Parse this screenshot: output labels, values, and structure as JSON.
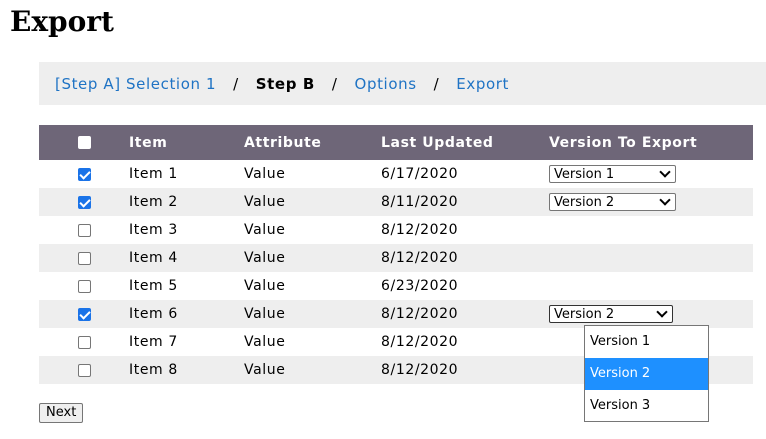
{
  "page": {
    "title": "Export"
  },
  "breadcrumb": {
    "step_a": "[Step A] Selection 1",
    "step_b": "Step B",
    "options": "Options",
    "export": "Export",
    "separator": "/"
  },
  "table": {
    "headers": {
      "item": "Item",
      "attribute": "Attribute",
      "last_updated": "Last Updated",
      "version_to_export": "Version To Export"
    },
    "header_checked": false,
    "rows": [
      {
        "checked": true,
        "item": "Item 1",
        "attribute": "Value",
        "last_updated": "6/17/2020",
        "version": "Version 1"
      },
      {
        "checked": true,
        "item": "Item 2",
        "attribute": "Value",
        "last_updated": "8/11/2020",
        "version": "Version 2"
      },
      {
        "checked": false,
        "item": "Item 3",
        "attribute": "Value",
        "last_updated": "8/12/2020",
        "version": ""
      },
      {
        "checked": false,
        "item": "Item 4",
        "attribute": "Value",
        "last_updated": "8/12/2020",
        "version": ""
      },
      {
        "checked": false,
        "item": "Item 5",
        "attribute": "Value",
        "last_updated": "6/23/2020",
        "version": ""
      },
      {
        "checked": true,
        "item": "Item 6",
        "attribute": "Value",
        "last_updated": "8/12/2020",
        "version": "Version 2"
      },
      {
        "checked": false,
        "item": "Item 7",
        "attribute": "Value",
        "last_updated": "8/12/2020",
        "version": ""
      },
      {
        "checked": false,
        "item": "Item 8",
        "attribute": "Value",
        "last_updated": "8/12/2020",
        "version": ""
      }
    ]
  },
  "dropdown": {
    "open_row": 6,
    "options": [
      {
        "label": "Version 1",
        "selected": false
      },
      {
        "label": "Version 2",
        "selected": true
      },
      {
        "label": "Version 3",
        "selected": false
      }
    ]
  },
  "actions": {
    "next_label": "Next"
  },
  "colors": {
    "header_bg": "#6e6678",
    "link": "#1f73c4",
    "stripe": "#eeeeee",
    "checkbox_checked": "#1a73e8",
    "option_selected": "#1e90ff"
  }
}
